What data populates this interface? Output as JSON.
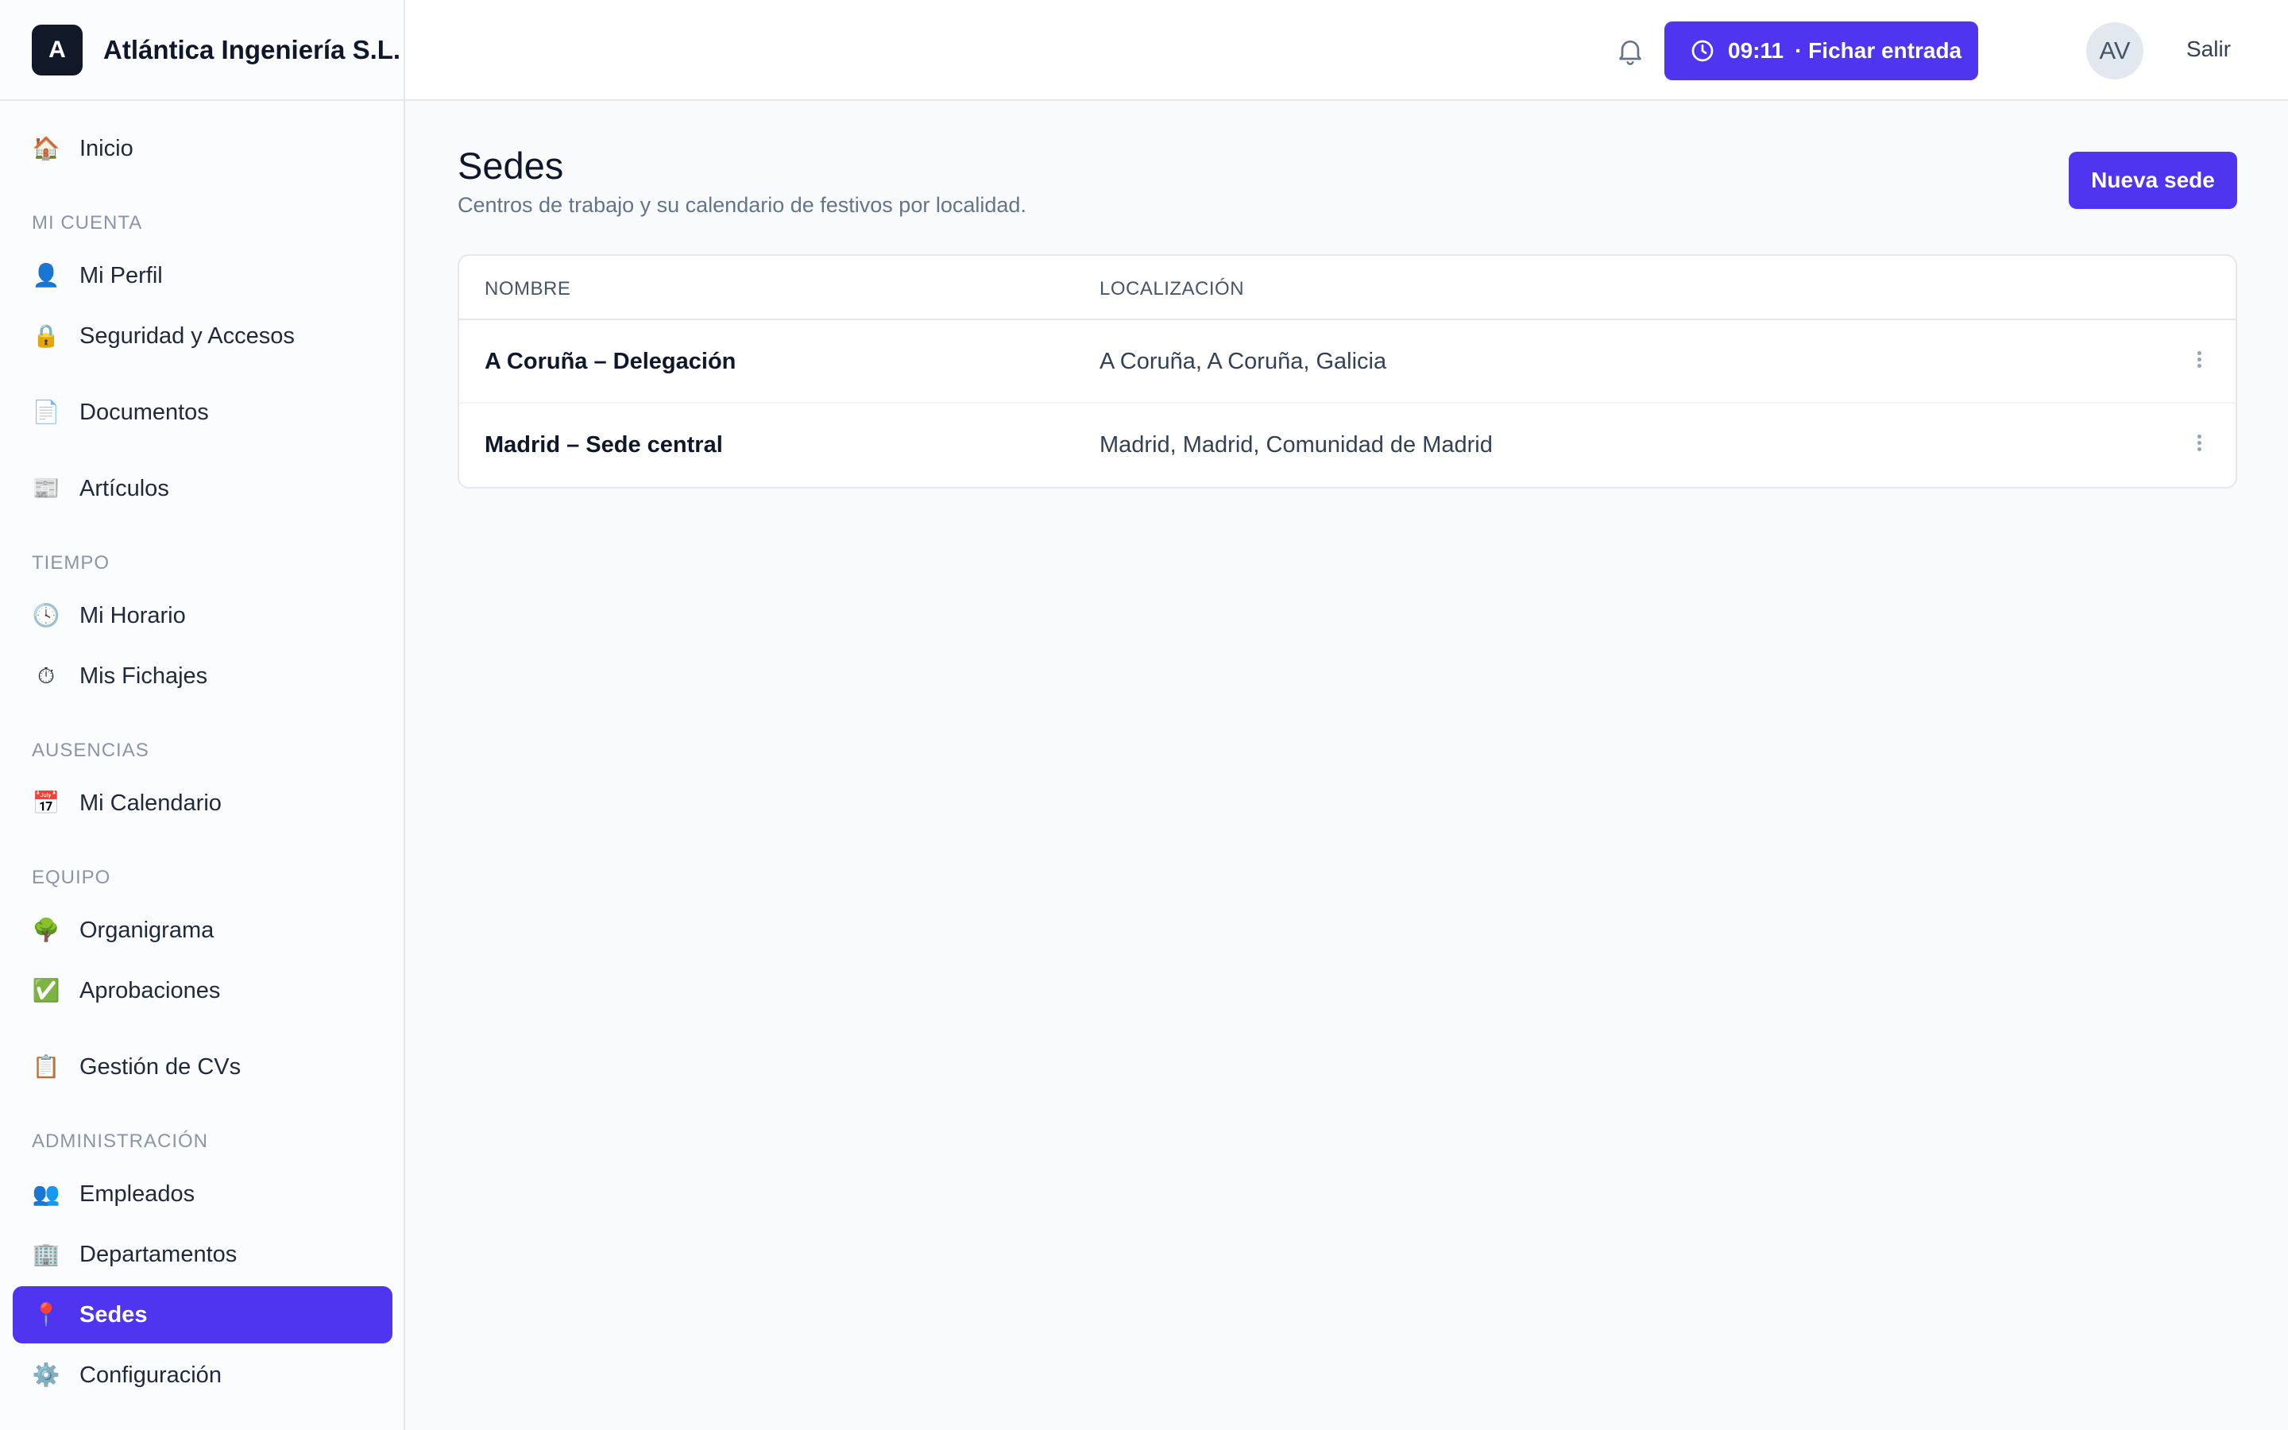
{
  "brand": {
    "logo_letter": "A",
    "name": "Atlántica Ingeniería S.L."
  },
  "header": {
    "clock_time": "09:11",
    "clock_action": "· Fichar entrada",
    "avatar_initials": "AV",
    "logout_label": "Salir"
  },
  "sidebar": {
    "top_item": {
      "label": "Inicio",
      "icon": "house-icon"
    },
    "sections": {
      "account": "MI CUENTA",
      "time": "TIEMPO",
      "absences": "AUSENCIAS",
      "team": "EQUIPO",
      "admin": "ADMINISTRACIÓN"
    },
    "items": {
      "perfil": "Mi Perfil",
      "seguridad": "Seguridad y Accesos",
      "documentos": "Documentos",
      "articulos": "Artículos",
      "horario": "Mi Horario",
      "fichajes": "Mis Fichajes",
      "calendario": "Mi Calendario",
      "organigrama": "Organigrama",
      "aprobaciones": "Aprobaciones",
      "cvs": "Gestión de CVs",
      "empleados": "Empleados",
      "departamentos": "Departamentos",
      "sedes": "Sedes",
      "configuracion": "Configuración"
    },
    "active_item": "Sedes"
  },
  "main": {
    "title": "Sedes",
    "subtitle": "Centros de trabajo y su calendario de festivos por localidad.",
    "new_button": "Nueva sede",
    "table": {
      "columns": [
        "NOMBRE",
        "LOCALIZACIÓN"
      ],
      "rows": [
        {
          "name": "A Coruña – Delegación",
          "location": "A Coruña, A Coruña, Galicia"
        },
        {
          "name": "Madrid – Sede central",
          "location": "Madrid, Madrid, Comunidad de Madrid"
        }
      ]
    }
  },
  "colors": {
    "accent": "#4f35f0",
    "border": "#e5e7eb",
    "muted": "#64748b"
  }
}
